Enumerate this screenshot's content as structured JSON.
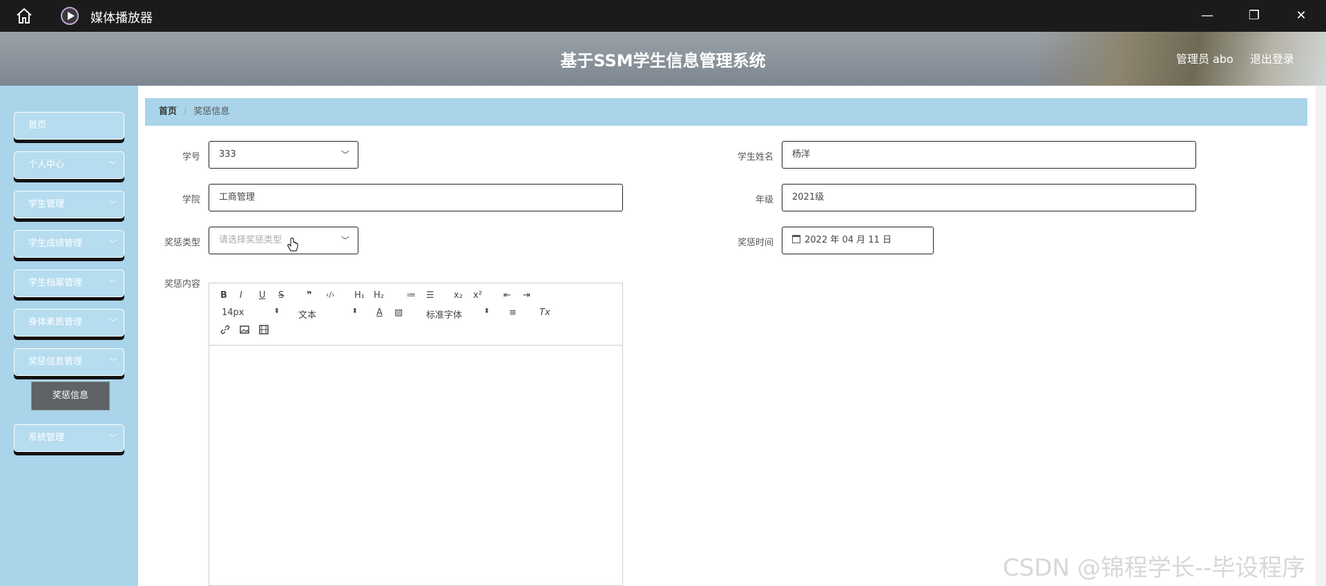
{
  "window": {
    "title": "媒体播放器",
    "home_icon": "home-icon",
    "logo_icon": "play-circle-icon"
  },
  "header": {
    "title": "基于SSM学生信息管理系统",
    "user": "管理员 abo",
    "logout": "退出登录"
  },
  "sidebar": {
    "items": [
      {
        "label": "首页",
        "has_children": false
      },
      {
        "label": "个人中心",
        "has_children": true
      },
      {
        "label": "学生管理",
        "has_children": true
      },
      {
        "label": "学生成绩管理",
        "has_children": true
      },
      {
        "label": "学生档案管理",
        "has_children": true
      },
      {
        "label": "身体素质管理",
        "has_children": true
      },
      {
        "label": "奖惩信息管理",
        "has_children": true
      },
      {
        "label": "系统管理",
        "has_children": true
      }
    ],
    "submenu_active": "奖惩信息"
  },
  "breadcrumb": {
    "home": "首页",
    "separator": "/",
    "current": "奖惩信息"
  },
  "form": {
    "student_id": {
      "label": "学号",
      "value": "333"
    },
    "student_name": {
      "label": "学生姓名",
      "value": "杨洋"
    },
    "college": {
      "label": "学院",
      "value": "工商管理"
    },
    "grade": {
      "label": "年级",
      "value": "2021级"
    },
    "award_type": {
      "label": "奖惩类型",
      "placeholder": "请选择奖惩类型"
    },
    "award_time": {
      "label": "奖惩时间",
      "value": "2022 年 04 月 11 日"
    },
    "content": {
      "label": "奖惩内容"
    }
  },
  "editor": {
    "row1": [
      "B",
      "I",
      "U",
      "S",
      "❞",
      "‹/›",
      "H₁",
      "H₂",
      "≔",
      "☰",
      "x₂",
      "x²",
      "⇤",
      "⇥"
    ],
    "font_size": "14px",
    "header": "文本",
    "font_family": "标准字体",
    "row2_icons": [
      "A",
      "▨",
      "≡",
      "Tx"
    ],
    "row3_icons": [
      "link-icon",
      "image-icon",
      "video-icon"
    ]
  },
  "watermark": "CSDN @锦程学长--毕设程序"
}
